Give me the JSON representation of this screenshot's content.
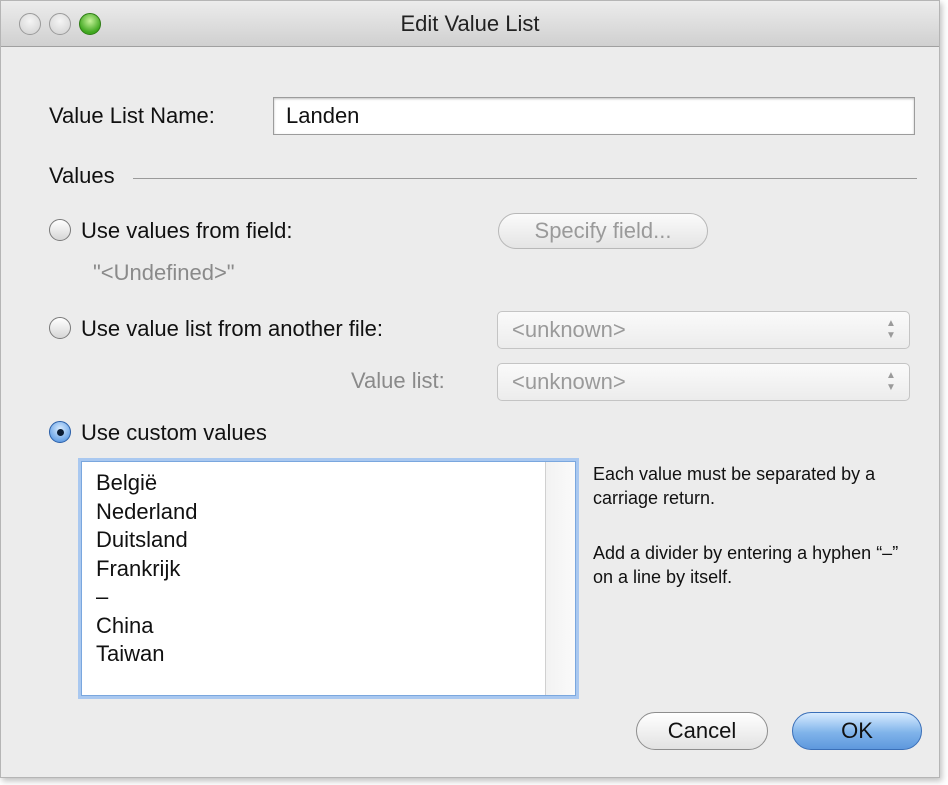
{
  "window": {
    "title": "Edit Value List",
    "traffic_lights": [
      "close-icon",
      "minimize-icon",
      "zoom-icon"
    ]
  },
  "name_field": {
    "label": "Value List Name:",
    "value": "Landen"
  },
  "values_section": {
    "label": "Values"
  },
  "option_field": {
    "label": "Use values from field:",
    "selected": false,
    "button_label": "Specify field...",
    "field_value": "\"<Undefined>\""
  },
  "option_file": {
    "label": "Use value list from another file:",
    "selected": false,
    "file_select_value": "<unknown>",
    "value_list_label": "Value list:",
    "value_list_select_value": "<unknown>"
  },
  "option_custom": {
    "label": "Use custom values",
    "selected": true,
    "values": [
      "België",
      "Nederland",
      "Duitsland",
      "Frankrijk",
      "–",
      "China",
      "Taiwan"
    ],
    "help_1": "Each value must be separated by a carriage return.",
    "help_2": "Add a divider by entering a hyphen “–” on a line by itself."
  },
  "footer": {
    "cancel_label": "Cancel",
    "ok_label": "OK"
  },
  "colors": {
    "accent": "#6fa7e8",
    "window_bg": "#ececec",
    "disabled_text": "#8a8a8a"
  }
}
